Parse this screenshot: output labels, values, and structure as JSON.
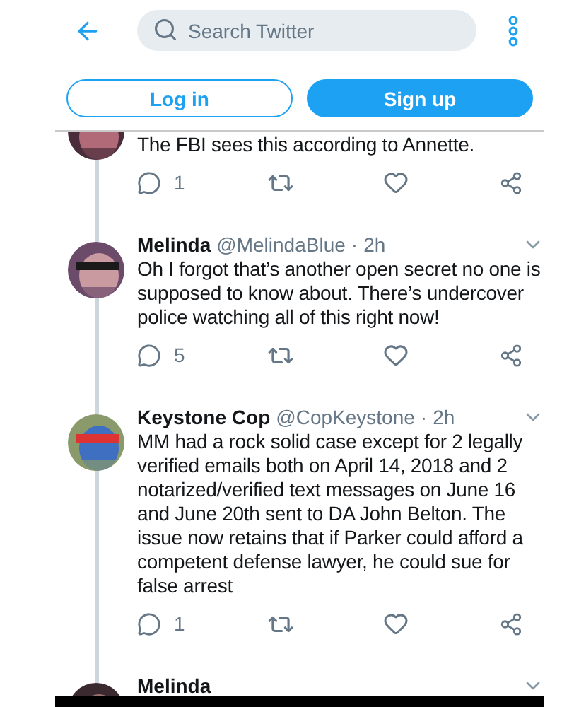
{
  "header": {
    "search": {
      "placeholder": "Search Twitter"
    }
  },
  "auth_buttons": [
    {
      "label": "Log in",
      "kind": "outline"
    },
    {
      "label": "Sign up",
      "kind": "filled"
    }
  ],
  "tweets": [
    {
      "text": "The FBI sees this according to Annette.",
      "replies": "1"
    },
    {
      "name": "Melinda",
      "handle": "@MelindaBlue",
      "separator": "·",
      "time": "2h",
      "text": "Oh I forgot that’s another open secret no one is supposed to know about.  There’s undercover police watching all of this right now!",
      "replies": "5"
    },
    {
      "name": "Keystone Cop",
      "handle": "@CopKeystone",
      "separator": "·",
      "time": "2h",
      "text": "MM had a rock solid case except for 2 legally verified emails both on April 14, 2018 and 2 notarized/verified text messages on June 16 and June 20th sent to DA John Belton. The issue now retains that if Parker could afford a competent defense lawyer, he could sue for false arrest",
      "replies": "1"
    },
    {
      "name": "Melinda"
    }
  ]
}
